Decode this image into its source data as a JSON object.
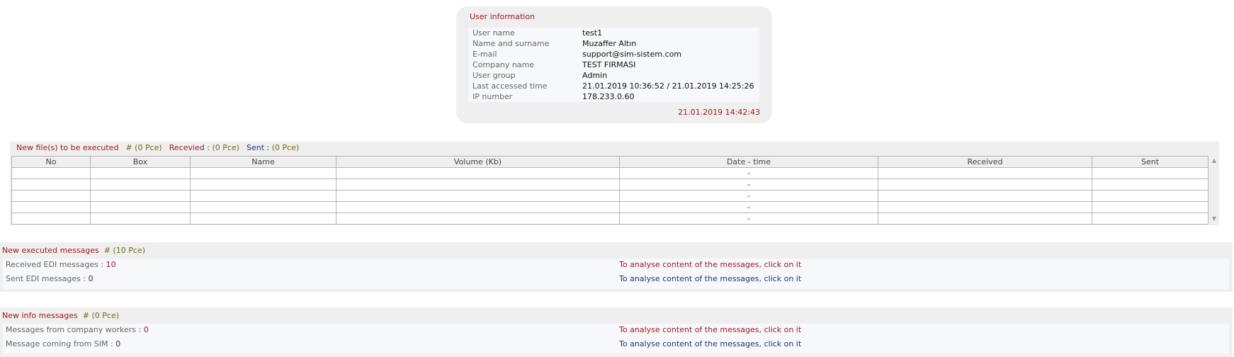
{
  "user_info": {
    "title": "User information",
    "fields": [
      {
        "label": "User name",
        "value": "test1"
      },
      {
        "label": "Name and surname",
        "value": "Muzaffer Altın"
      },
      {
        "label": "E-mail",
        "value": "support@sim-sistem.com"
      },
      {
        "label": "Company name",
        "value": "TEST FIRMASI"
      },
      {
        "label": "User group",
        "value": "Admin"
      },
      {
        "label": "Last accessed time",
        "value": "21.01.2019 10:36:52 / 21.01.2019 14:25:26"
      },
      {
        "label": "IP number",
        "value": "178.233.0.60"
      }
    ],
    "timestamp": "21.01.2019 14:42:43"
  },
  "files": {
    "title": "New file(s) to be executed",
    "count": "# (0 Pce)",
    "received_label": "Recevied : ",
    "received_count": "(0 Pce)",
    "sent_label": "Sent : ",
    "sent_count": "(0 Pce)",
    "columns": [
      "No",
      "Box",
      "Name",
      "Volume (Kb)",
      "Date - time",
      "Received",
      "Sent"
    ],
    "rows": [
      [
        "",
        "",
        "",
        "",
        "-",
        "",
        ""
      ],
      [
        "",
        "",
        "",
        "",
        "-",
        "",
        ""
      ],
      [
        "",
        "",
        "",
        "",
        "-",
        "",
        ""
      ],
      [
        "",
        "",
        "",
        "",
        "-",
        "",
        ""
      ],
      [
        "",
        "",
        "",
        "",
        "-",
        "",
        ""
      ]
    ]
  },
  "executed": {
    "title": "New executed messages",
    "count": "# (10 Pce)",
    "rows": [
      {
        "label": "Received EDI messages : ",
        "value": "10",
        "link": "To analyse content of the messages, click on it"
      },
      {
        "label": "Sent EDI messages : ",
        "value": "0",
        "link": "To analyse content of the messages, click on it"
      }
    ]
  },
  "info": {
    "title": "New info messages",
    "count": "# (0 Pce)",
    "rows": [
      {
        "label": "Messages from company workers : ",
        "value": "0",
        "link": "To analyse content of the messages, click on it"
      },
      {
        "label": "Message coming from SIM : ",
        "value": "0",
        "link": "To analyse content of the messages, click on it"
      }
    ]
  },
  "colors": {
    "red": "#a11a1a",
    "olive": "#7a6a10",
    "navy": "#1f3575",
    "panel": "#efefef"
  }
}
